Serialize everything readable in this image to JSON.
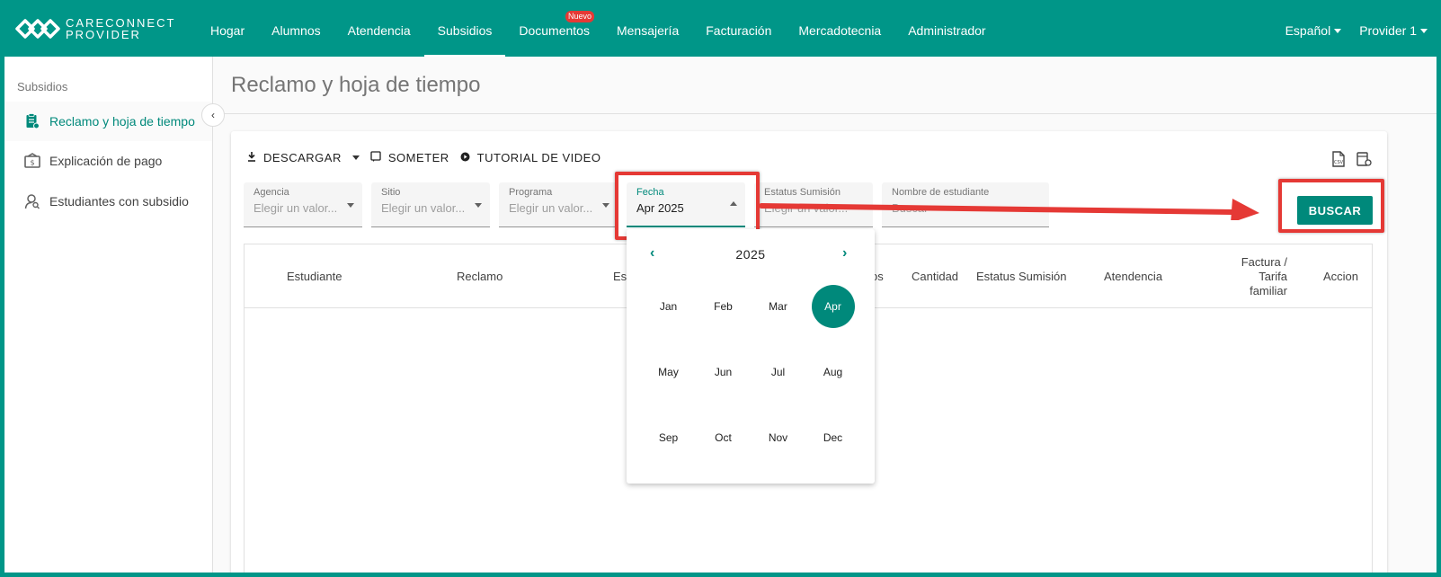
{
  "brand": {
    "line1": "CARECONNECT",
    "line2": "PROVIDER"
  },
  "nav": {
    "items": [
      {
        "label": "Hogar"
      },
      {
        "label": "Alumnos"
      },
      {
        "label": "Atendencia"
      },
      {
        "label": "Subsidios"
      },
      {
        "label": "Documentos",
        "badge": "Nuevo"
      },
      {
        "label": "Mensajería"
      },
      {
        "label": "Facturación"
      },
      {
        "label": "Mercadotecnia"
      },
      {
        "label": "Administrador"
      }
    ],
    "language": "Español",
    "user": "Provider 1"
  },
  "sidebar": {
    "title": "Subsidios",
    "items": [
      {
        "label": "Reclamo y hoja de tiempo",
        "icon": "clipboard-icon"
      },
      {
        "label": "Explicación de pago",
        "icon": "bank-icon"
      },
      {
        "label": "Estudiantes con subsidio",
        "icon": "user-search-icon"
      }
    ]
  },
  "page": {
    "title": "Reclamo y hoja de tiempo"
  },
  "toolbar": {
    "download": "DESCARGAR",
    "submit": "SOMETER",
    "tutorial": "TUTORIAL DE VIDEO"
  },
  "filters": {
    "agencia": {
      "label": "Agencia",
      "placeholder": "Elegir un valor..."
    },
    "sitio": {
      "label": "Sitio",
      "placeholder": "Elegir un valor..."
    },
    "programa": {
      "label": "Programa",
      "placeholder": "Elegir un valor..."
    },
    "fecha": {
      "label": "Fecha",
      "value": "Apr 2025"
    },
    "estatus": {
      "label": "Estatus Sumisión",
      "placeholder": "Elegir un valor..."
    },
    "nombre": {
      "label": "Nombre de estudiante",
      "placeholder": "Buscar"
    }
  },
  "search_button": "BUSCAR",
  "table": {
    "headers": [
      "Estudiante",
      "Reclamo",
      "Es",
      "os",
      "Cantidad",
      "Estatus Sumisión",
      "Atendencia",
      "Factura / Tarifa familiar",
      "Accion"
    ]
  },
  "picker": {
    "year": "2025",
    "selected": "Apr",
    "months": [
      "Jan",
      "Feb",
      "Mar",
      "Apr",
      "May",
      "Jun",
      "Jul",
      "Aug",
      "Sep",
      "Oct",
      "Nov",
      "Dec"
    ]
  },
  "colors": {
    "brand": "#009688",
    "accent": "#00897b",
    "highlight": "#e53935"
  }
}
